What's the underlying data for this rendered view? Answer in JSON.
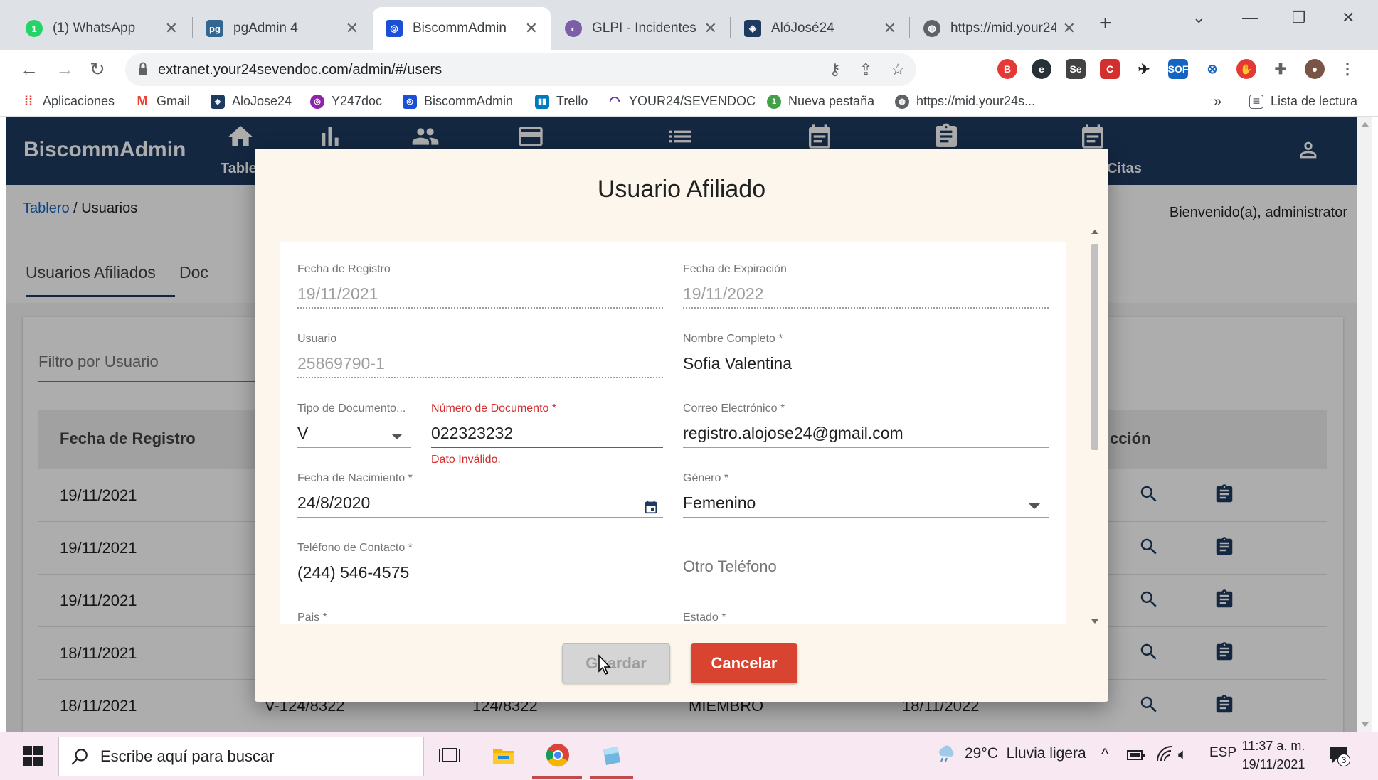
{
  "browser": {
    "tabs": [
      {
        "title": "(1) WhatsApp",
        "icon": "whatsapp-icon",
        "color": "#25d366"
      },
      {
        "title": "pgAdmin 4",
        "icon": "pgadmin-icon",
        "color": "#336791"
      },
      {
        "title": "BiscommAdmin",
        "icon": "biscomm-icon",
        "color": "#1a4fd6"
      },
      {
        "title": "GLPI - Incidentes -",
        "icon": "glpi-icon",
        "color": "#7b5ea7"
      },
      {
        "title": "AlóJosé24",
        "icon": "alojose-icon",
        "color": "#1e3a5f"
      },
      {
        "title": "https://mid.your24s",
        "icon": "globe-icon",
        "color": "#5f6368"
      }
    ],
    "url": "extranet.your24sevendoc.com/admin/#/users",
    "bookmarks": [
      {
        "label": "Aplicaciones"
      },
      {
        "label": "Gmail"
      },
      {
        "label": "AloJose24"
      },
      {
        "label": "Y247doc"
      },
      {
        "label": "BiscommAdmin"
      },
      {
        "label": "Trello"
      },
      {
        "label": "YOUR24/SEVENDOC"
      },
      {
        "label": "Nueva pestaña"
      },
      {
        "label": "https://mid.your24s..."
      }
    ],
    "reading_list": "Lista de lectura",
    "more_bookmarks": "»"
  },
  "app": {
    "brand": "BiscommAdmin",
    "nav_partial_left": "Table",
    "nav_partial_right": "Citas",
    "breadcrumb_root": "Tablero",
    "breadcrumb_sep": " / ",
    "breadcrumb_current": "Usuarios",
    "welcome": "Bienvenido(a), administrator",
    "page_tabs": [
      "Usuarios Afiliados",
      "Doc"
    ],
    "filter_placeholder": "Filtro por Usuario",
    "table": {
      "col_fecha": "Fecha de Registro",
      "col_accion_partial": "cción",
      "rows": [
        {
          "fecha": "19/11/2021"
        },
        {
          "fecha": "19/11/2021"
        },
        {
          "fecha": "19/11/2021"
        },
        {
          "fecha": "18/11/2021"
        },
        {
          "fecha": "18/11/2021",
          "c2": "V-124/8322",
          "c3": "124/8322",
          "c4": "MIEMBRO",
          "c5": "18/11/2022"
        }
      ]
    }
  },
  "modal": {
    "title": "Usuario Afiliado",
    "fields": {
      "fecha_registro": {
        "label": "Fecha de Registro",
        "value": "19/11/2021"
      },
      "fecha_expiracion": {
        "label": "Fecha de Expiración",
        "value": "19/11/2022"
      },
      "usuario": {
        "label": "Usuario",
        "value": "25869790-1"
      },
      "nombre": {
        "label": "Nombre Completo *",
        "value": "Sofia Valentina"
      },
      "tipo_doc": {
        "label": "Tipo de Documento...",
        "value": "V"
      },
      "num_doc": {
        "label": "Número de Documento *",
        "value": "022323232",
        "error": "Dato Inválido."
      },
      "correo": {
        "label": "Correo Electrónico *",
        "value": "registro.alojose24@gmail.com"
      },
      "nacimiento": {
        "label": "Fecha de Nacimiento *",
        "value": "24/8/2020"
      },
      "genero": {
        "label": "Género *",
        "value": "Femenino"
      },
      "telefono": {
        "label": "Teléfono de Contacto *",
        "value": "(244) 546-4575"
      },
      "otro_tel": {
        "placeholder": "Otro Teléfono"
      },
      "pais": {
        "label": "Pais *"
      },
      "estado": {
        "label": "Estado *"
      }
    },
    "save_label": "Guardar",
    "cancel_label": "Cancelar"
  },
  "taskbar": {
    "search_placeholder": "Escribe aquí para buscar",
    "weather": "29°C  Lluvia ligera",
    "language": "ESP",
    "time": "11:37 a. m.",
    "date": "19/11/2021",
    "notifications": "3"
  },
  "colors": {
    "appbar": "#1e3a5f",
    "modal_bg": "#fdf6ec",
    "error": "#d32f2f",
    "cancel": "#d94430",
    "link": "#1565c0"
  }
}
